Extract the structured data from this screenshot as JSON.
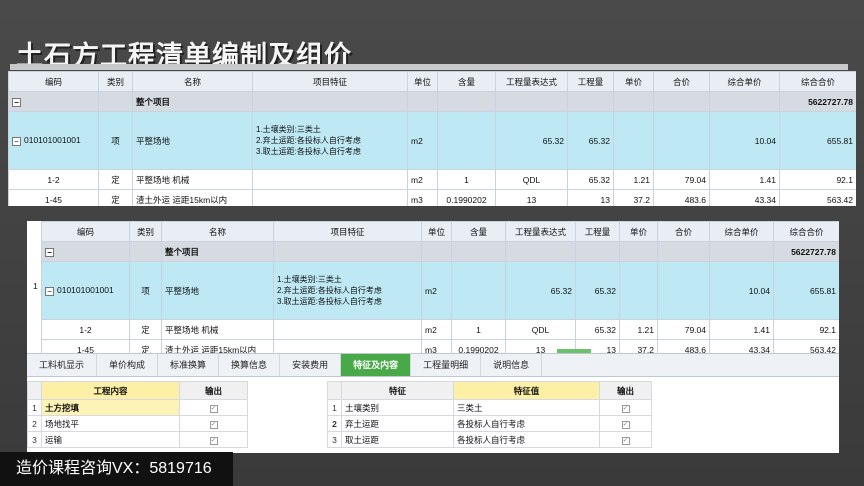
{
  "title": "土石方工程清单编制及组价",
  "footer": "造价课程咨询VX：5819716",
  "table": {
    "headers": [
      "编码",
      "类别",
      "名称",
      "项目特征",
      "单位",
      "含量",
      "工程量表达式",
      "工程量",
      "单价",
      "合价",
      "综合单价",
      "综合合价"
    ],
    "group": {
      "name": "整个项目",
      "total": "5622727.78"
    },
    "main": {
      "code": "010101001001",
      "type": "项",
      "name": "平整场地",
      "features": [
        "1.土壤类别:三类土",
        "2.弃土运距:各投标人自行考虑",
        "3.取土运距:各投标人自行考虑"
      ],
      "unit": "m2",
      "expr": "65.32",
      "qty": "65.32",
      "unit_total": "10.04",
      "total": "655.81"
    },
    "subs": [
      {
        "code": "1-2",
        "type": "定",
        "name": "平整场地 机械",
        "unit": "m2",
        "content": "1",
        "expr": "QDL",
        "qty": "65.32",
        "price": "1.21",
        "sum": "79.04",
        "unit_total": "1.41",
        "total": "92.1"
      },
      {
        "code": "1-45",
        "type": "定",
        "name": "渣土外运 运距15km以内",
        "unit": "m3",
        "content": "0.1990202",
        "expr": "13",
        "qty": "13",
        "price": "37.2",
        "sum": "483.6",
        "unit_total": "43.34",
        "total": "563.42"
      }
    ],
    "row_num": "1"
  },
  "tabs": [
    "工料机显示",
    "单价构成",
    "标准换算",
    "换算信息",
    "安装费用",
    "特征及内容",
    "工程量明细",
    "说明信息"
  ],
  "work": {
    "headers": [
      "工程内容",
      "输出"
    ],
    "rows": [
      {
        "idx": "1",
        "name": "土方挖填"
      },
      {
        "idx": "2",
        "name": "场地找平"
      },
      {
        "idx": "3",
        "name": "运输"
      }
    ]
  },
  "features": {
    "headers": [
      "特征",
      "特征值",
      "输出"
    ],
    "rows": [
      {
        "idx": "1",
        "name": "土壤类别",
        "value": "三类土"
      },
      {
        "idx": "2",
        "name": "弃土运距",
        "value": "各投标人自行考虑"
      },
      {
        "idx": "3",
        "name": "取土运距",
        "value": "各投标人自行考虑"
      }
    ]
  }
}
